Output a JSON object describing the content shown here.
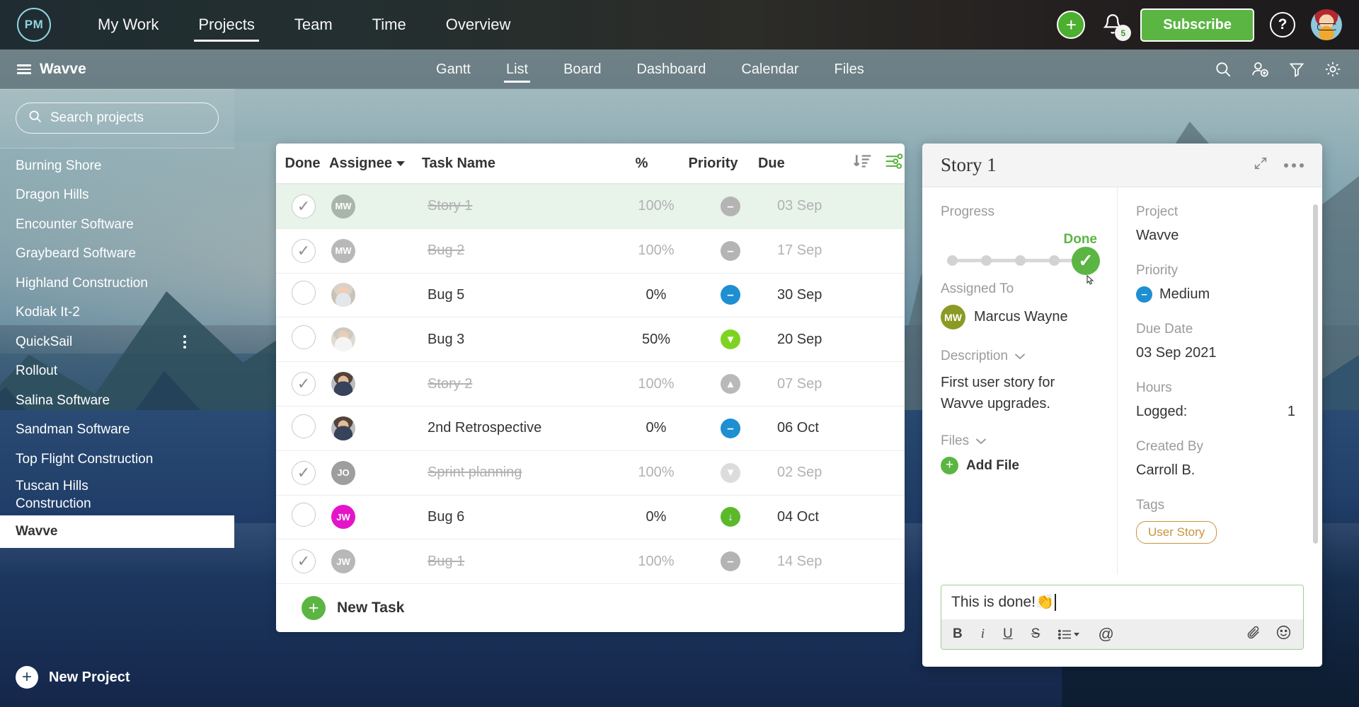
{
  "topnav": {
    "logo_text": "PM",
    "links": [
      {
        "label": "My Work",
        "active": false
      },
      {
        "label": "Projects",
        "active": true
      },
      {
        "label": "Team",
        "active": false
      },
      {
        "label": "Time",
        "active": false
      },
      {
        "label": "Overview",
        "active": false
      }
    ],
    "add_icon": "plus-icon",
    "notification_icon": "bell-icon",
    "notification_count": "5",
    "subscribe_label": "Subscribe",
    "help_label": "?",
    "avatar_alt": "user-avatar"
  },
  "subnav": {
    "project_name": "Wavve",
    "tabs": [
      {
        "label": "Gantt",
        "active": false
      },
      {
        "label": "List",
        "active": true
      },
      {
        "label": "Board",
        "active": false
      },
      {
        "label": "Dashboard",
        "active": false
      },
      {
        "label": "Calendar",
        "active": false
      },
      {
        "label": "Files",
        "active": false
      }
    ],
    "icons": [
      "search-icon",
      "add-person-icon",
      "filter-icon",
      "gear-icon"
    ]
  },
  "sidebar": {
    "search_placeholder": "Search projects",
    "projects": [
      {
        "label": "Burning Shore",
        "active": false,
        "menu": false
      },
      {
        "label": "Dragon Hills",
        "active": false,
        "menu": false
      },
      {
        "label": "Encounter Software",
        "active": false,
        "menu": false
      },
      {
        "label": "Graybeard Software",
        "active": false,
        "menu": false
      },
      {
        "label": "Highland Construction",
        "active": false,
        "menu": false
      },
      {
        "label": "Kodiak It-2",
        "active": false,
        "menu": false
      },
      {
        "label": "QuickSail",
        "active": false,
        "menu": true
      },
      {
        "label": "Rollout",
        "active": false,
        "menu": false
      },
      {
        "label": "Salina Software",
        "active": false,
        "menu": false
      },
      {
        "label": "Sandman Software",
        "active": false,
        "menu": false
      },
      {
        "label": "Top Flight Construction",
        "active": false,
        "menu": false
      },
      {
        "label": "Tuscan Hills Construction",
        "active": false,
        "menu": false,
        "two_line": true
      },
      {
        "label": "Wavve",
        "active": true,
        "menu": false
      }
    ],
    "new_project_label": "New Project"
  },
  "table": {
    "columns": [
      "Done",
      "Assignee",
      "Task Name",
      "%",
      "Priority",
      "Due"
    ],
    "sort_icon": "sort-descending-icon",
    "settings_icon": "column-settings-icon",
    "rows": [
      {
        "done": true,
        "initials": "MW",
        "avatar_kind": "initials",
        "avatar_color": "#a9b5a8",
        "name": "Story 1",
        "pct": "100%",
        "priority": "medium-grey",
        "prio_glyph": "–",
        "due": "03 Sep",
        "selected": true
      },
      {
        "done": true,
        "initials": "MW",
        "avatar_kind": "initials",
        "avatar_color": "#b8b8b8",
        "name": "Bug 2",
        "pct": "100%",
        "priority": "medium-grey",
        "prio_glyph": "–",
        "due": "17 Sep",
        "selected": false
      },
      {
        "done": false,
        "initials": "",
        "avatar_kind": "photo-f1",
        "avatar_color": "",
        "name": "Bug 5",
        "pct": "0%",
        "priority": "medium",
        "prio_glyph": "–",
        "due": "30 Sep",
        "selected": false
      },
      {
        "done": false,
        "initials": "",
        "avatar_kind": "photo-f2",
        "avatar_color": "",
        "name": "Bug 3",
        "pct": "50%",
        "priority": "low",
        "prio_glyph": "▼",
        "due": "20 Sep",
        "selected": false
      },
      {
        "done": true,
        "initials": "",
        "avatar_kind": "photo-m1",
        "avatar_color": "",
        "name": "Story 2",
        "pct": "100%",
        "priority": "high-grey",
        "prio_glyph": "▲",
        "due": "07 Sep",
        "selected": false
      },
      {
        "done": false,
        "initials": "",
        "avatar_kind": "photo-m2",
        "avatar_color": "",
        "name": "2nd Retrospective",
        "pct": "0%",
        "priority": "medium",
        "prio_glyph": "–",
        "due": "06 Oct",
        "selected": false
      },
      {
        "done": true,
        "initials": "JO",
        "avatar_kind": "initials",
        "avatar_color": "#9e9e9e",
        "name": "Sprint planning",
        "pct": "100%",
        "priority": "low-grey",
        "prio_glyph": "▼",
        "due": "02 Sep",
        "selected": false
      },
      {
        "done": false,
        "initials": "JW",
        "avatar_kind": "initials",
        "avatar_color": "#e614c8",
        "name": "Bug 6",
        "pct": "0%",
        "priority": "low-dark",
        "prio_glyph": "↓",
        "due": "04 Oct",
        "selected": false
      },
      {
        "done": true,
        "initials": "JW",
        "avatar_kind": "initials",
        "avatar_color": "#b8b8b8",
        "name": "Bug 1",
        "pct": "100%",
        "priority": "medium-grey",
        "prio_glyph": "–",
        "due": "14 Sep",
        "selected": false
      }
    ],
    "new_task_label": "New Task"
  },
  "detail": {
    "title": "Story 1",
    "expand_icon": "expand-icon",
    "more_icon": "more-options-icon",
    "progress_label": "Progress",
    "progress_status": "Done",
    "progress_nodes": 4,
    "assigned_label": "Assigned To",
    "assigned_initials": "MW",
    "assigned_name": "Marcus Wayne",
    "description_label": "Description",
    "description_text": "First user story for Wavve upgrades.",
    "files_label": "Files",
    "add_file_label": "Add File",
    "project_label": "Project",
    "project_value": "Wavve",
    "priority_label": "Priority",
    "priority_value": "Medium",
    "due_label": "Due Date",
    "due_value": "03 Sep 2021",
    "hours_label": "Hours",
    "hours_logged_label": "Logged:",
    "hours_logged_value": "1",
    "created_label": "Created By",
    "created_value": "Carroll B.",
    "tags_label": "Tags",
    "tag_value": "User Story",
    "comment_text": "This is done!",
    "comment_emoji": "👏",
    "toolbar": {
      "bold": "B",
      "italic": "i",
      "underline": "U",
      "strike": "S",
      "list": "list-icon",
      "mention": "@",
      "attach": "paperclip-icon",
      "emoji": "emoji-icon"
    }
  },
  "colors": {
    "accent_green": "#5bb543",
    "priority_medium_blue": "#1e8fd1",
    "priority_low_green": "#7ed321",
    "tag_orange": "#c8943c",
    "selected_row": "#e8f3ea"
  }
}
